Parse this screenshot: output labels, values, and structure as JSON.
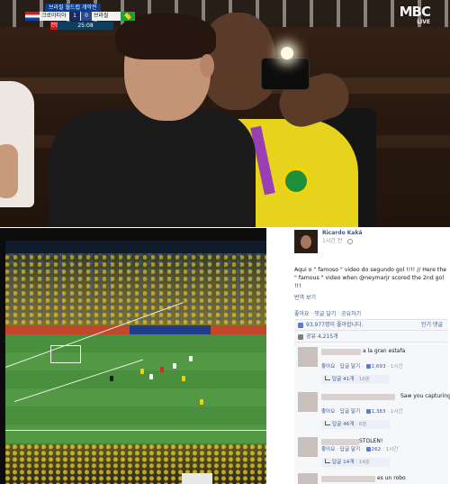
{
  "broadcast": {
    "scoreboard": {
      "title": "브라질 월드컵 개막전",
      "team_home": "크로아티아",
      "team_away": "브라질",
      "score_home": "1",
      "score_away": "0",
      "period": "전반",
      "clock": "25:08"
    },
    "channel": {
      "name": "MBC",
      "live": "LIVE"
    }
  },
  "post": {
    "author": "Ricardo Kaká",
    "time": "1시간 전",
    "text": "Aqui o \" famoso \" video do segundo gol !!!! // Here the \" famous \" video when @neymarjr scored the 2nd gol !!!",
    "see_translation": "번역 보기",
    "actions": {
      "like": "좋아요",
      "comment": "댓글 달기",
      "share": "공유하기",
      "sep": "·"
    },
    "likes_text": "93,977명이 좋아합니다.",
    "sort_label": "인기 댓글",
    "shares_text": "공유 4,215개",
    "comments": [
      {
        "text": "a la gran estafa",
        "like": "좋아요",
        "reply": "답글 달기",
        "likes": "1,693",
        "time": "1시간",
        "reply_count": "답글 41개",
        "reply_time": "16분"
      },
      {
        "text": "Saw you capturing",
        "like": "좋아요",
        "reply": "답글 달기",
        "likes": "1,383",
        "time": "1시간",
        "reply_count": "답글 46개",
        "reply_time": "6분"
      },
      {
        "text": "STOLEN!",
        "like": "좋아요",
        "reply": "답글 달기",
        "likes": "262",
        "time": "1시간",
        "reply_count": "답글 14개",
        "reply_time": "14분"
      },
      {
        "text": "es un robo"
      }
    ]
  }
}
